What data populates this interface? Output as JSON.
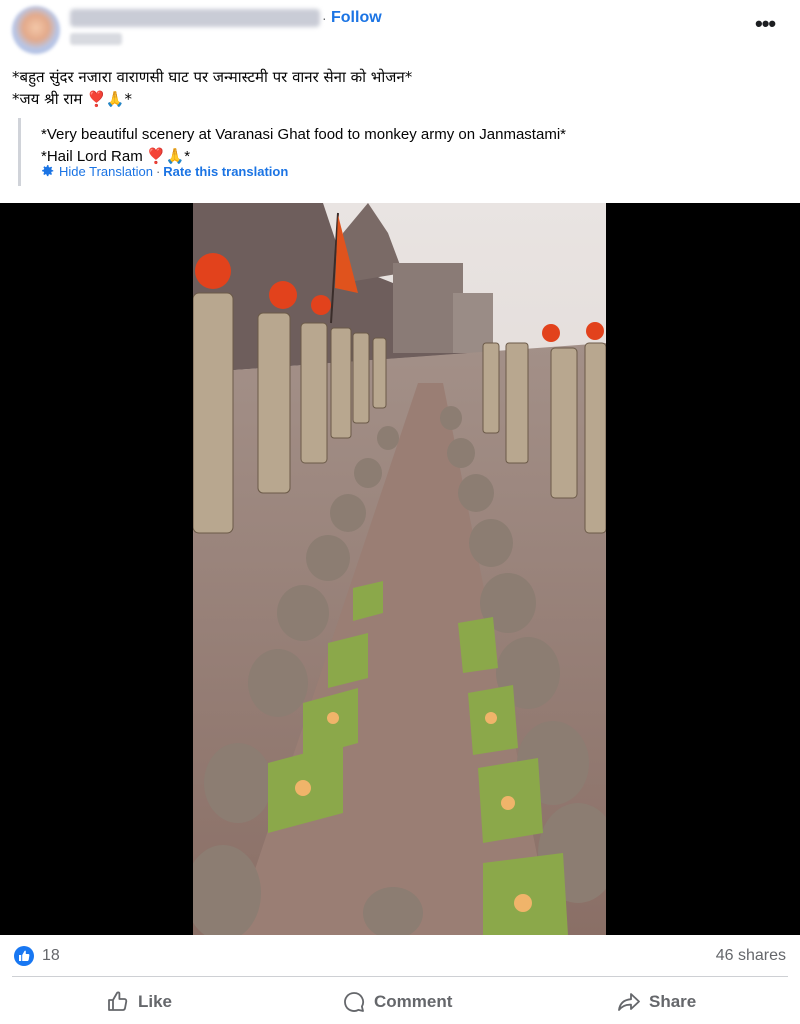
{
  "header": {
    "separator": "·",
    "follow_label": "Follow",
    "more_label": "•••"
  },
  "post": {
    "text_line1": "*बहुत सुंदर नजारा वाराणसी घाट पर जन्मास्टमी पर वानर सेना को भोजन*",
    "text_line2": "*जय श्री राम ❣️🙏*",
    "translation_line1": "*Very beautiful scenery at Varanasi Ghat food to monkey army on Janmastami*",
    "translation_line2": "*Hail Lord Ram ❣️🙏*",
    "hide_translation_label": "Hide Translation",
    "link_separator": "·",
    "rate_translation_label": "Rate this translation"
  },
  "stats": {
    "like_count": "18",
    "shares": "46 shares"
  },
  "actions": {
    "like_label": "Like",
    "comment_label": "Comment",
    "share_label": "Share"
  },
  "colors": {
    "link_blue": "#1b74e4",
    "reaction_blue": "#1877f2",
    "secondary_text": "#65676b",
    "divider": "#ced0d4"
  },
  "icons": {
    "like_badge": "thumbs-up-icon",
    "gear": "gear-icon",
    "like_action": "thumbs-up-outline-icon",
    "comment_action": "speech-bubble-icon",
    "share_action": "share-arrow-icon"
  }
}
